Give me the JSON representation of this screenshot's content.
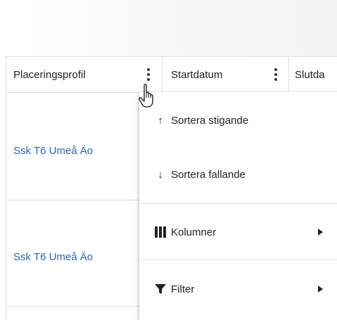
{
  "columns": [
    {
      "label": "Placeringsprofil"
    },
    {
      "label": "Startdatum"
    },
    {
      "label": "Slutda"
    }
  ],
  "rows": [
    {
      "placeringsprofil": "Ssk T6 Umeå Äo"
    },
    {
      "placeringsprofil": "Ssk T6 Umeå Äo"
    }
  ],
  "column_menu": {
    "sort_ascending": {
      "icon": "arrow-up-icon",
      "label": "Sortera stigande"
    },
    "sort_descending": {
      "icon": "arrow-down-icon",
      "label": "Sortera fallande"
    },
    "columns": {
      "icon": "columns-icon",
      "label": "Kolumner",
      "has_submenu": true
    },
    "filter": {
      "icon": "filter-icon",
      "label": "Filter",
      "has_submenu": true
    }
  },
  "colors": {
    "link": "#2a66b1",
    "border": "#e0e0e0",
    "text": "#222222"
  }
}
